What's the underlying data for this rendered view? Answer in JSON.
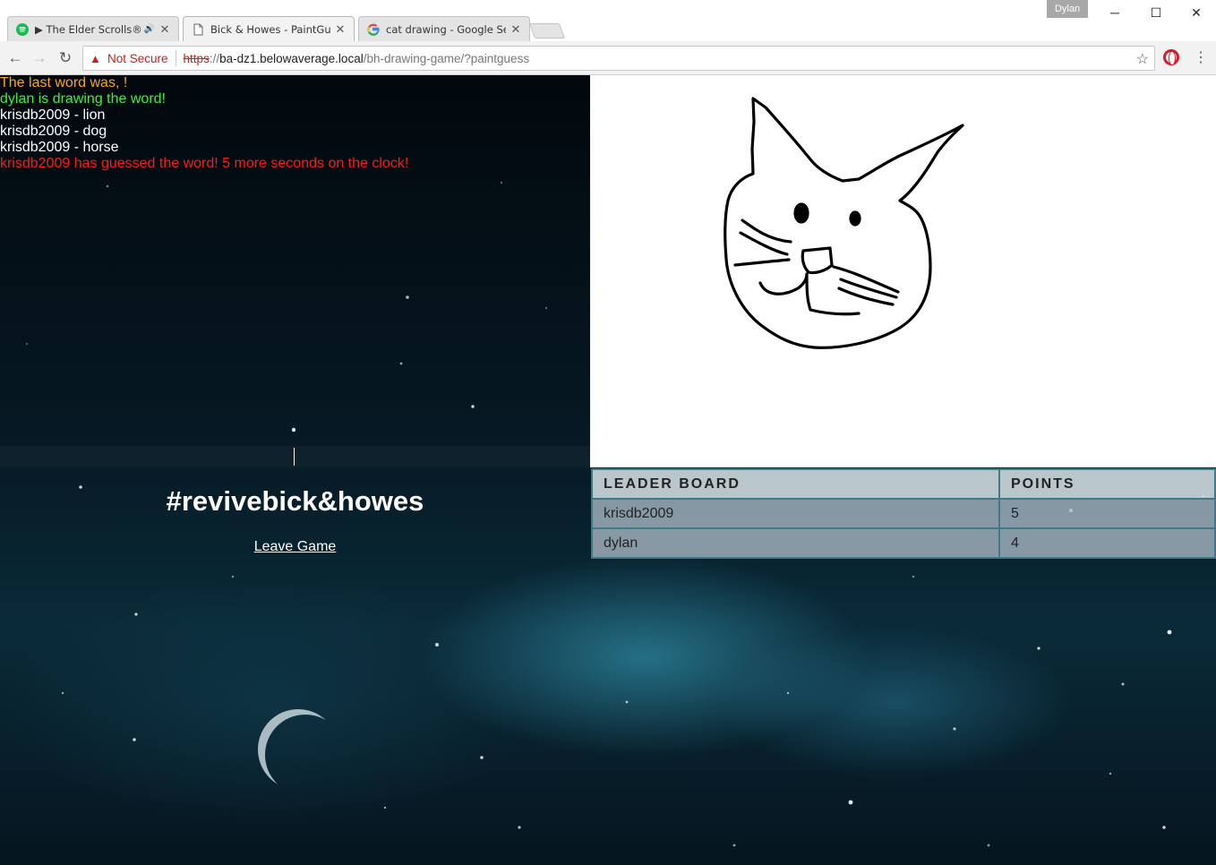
{
  "browser": {
    "tabs": [
      {
        "title": "The Elder Scrolls®",
        "icon": "spotify-icon",
        "playing": "▶",
        "audio": "🔊"
      },
      {
        "title": "Bick & Howes - PaintGue",
        "icon": "document-icon"
      },
      {
        "title": "cat drawing - Google Sea",
        "icon": "google-icon"
      }
    ],
    "profile_name": "Dylan",
    "security_label": "Not Secure",
    "url_scheme": "https",
    "url_sep": "://",
    "url_host": "ba-dz1.belowaverage.local",
    "url_path": "/bh-drawing-game/?paintguess"
  },
  "chat": {
    "lines": [
      {
        "text": "The last word was, !",
        "color": "orange"
      },
      {
        "text": "dylan is drawing the word!",
        "color": "green"
      },
      {
        "user": "krisdb2009",
        "sep": " - ",
        "word": "lion"
      },
      {
        "user": "krisdb2009",
        "sep": " - ",
        "word": "dog"
      },
      {
        "user": "krisdb2009",
        "sep": " - ",
        "word": "horse"
      },
      {
        "text": "krisdb2009 has guessed the word! 5 more seconds on the clock!",
        "color": "red"
      }
    ]
  },
  "sidebar": {
    "title": "#revivebick&howes",
    "leave_label": "Leave Game"
  },
  "leaderboard": {
    "headers": {
      "name": "LEADER BOARD",
      "points": "POINTS"
    },
    "rows": [
      {
        "name": "krisdb2009",
        "points": "5"
      },
      {
        "name": "dylan",
        "points": "4"
      }
    ]
  }
}
